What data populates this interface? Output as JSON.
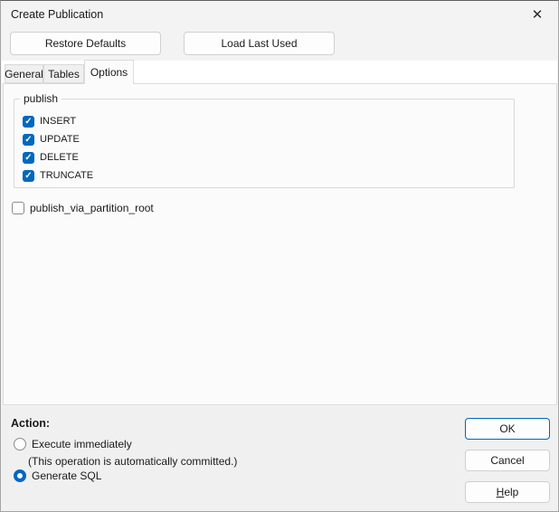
{
  "window": {
    "title": "Create Publication"
  },
  "icons": {
    "close": "✕",
    "check": "✓"
  },
  "header_buttons": {
    "restore_defaults": "Restore Defaults",
    "load_last_used": "Load Last Used"
  },
  "tabs": [
    {
      "label": "General",
      "active": false
    },
    {
      "label": "Tables",
      "active": false
    },
    {
      "label": "Options",
      "active": true
    }
  ],
  "options_tab": {
    "publish_group": {
      "label": "publish",
      "checkboxes": [
        {
          "label": "INSERT",
          "checked": true
        },
        {
          "label": "UPDATE",
          "checked": true
        },
        {
          "label": "DELETE",
          "checked": true
        },
        {
          "label": "TRUNCATE",
          "checked": true
        }
      ]
    },
    "partition_checkbox": {
      "label": "publish_via_partition_root",
      "checked": false
    }
  },
  "action_panel": {
    "label": "Action:",
    "radios": [
      {
        "label": "Execute immediately",
        "note": "(This operation is automatically committed.)",
        "selected": false
      },
      {
        "label": "Generate SQL",
        "selected": true
      }
    ]
  },
  "footer_buttons": {
    "ok": "OK",
    "cancel": "Cancel",
    "help_prefix": "H",
    "help_suffix": "elp"
  },
  "colors": {
    "accent": "#0067c0",
    "dialog_bg": "#f3f3f3",
    "tabpage_bg": "#fbfbfb",
    "actionbar_bg": "#f0f0f0"
  }
}
